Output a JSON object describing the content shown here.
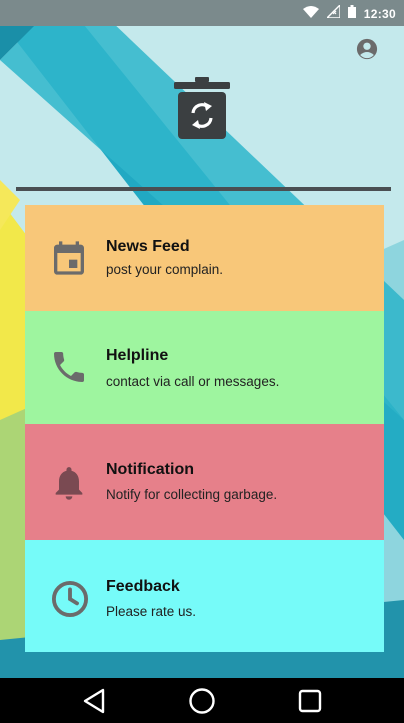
{
  "status_bar": {
    "time": "12:30",
    "icons": [
      "wifi-icon",
      "signal-icon",
      "battery-icon"
    ]
  },
  "header": {
    "profile_icon": "account-circle-icon",
    "logo_icon": "recycle-bin-icon"
  },
  "menu": [
    {
      "id": "news-feed",
      "title": "News Feed",
      "subtitle": "post your complain.",
      "icon": "calendar-icon",
      "color": "#f8c779"
    },
    {
      "id": "helpline",
      "title": "Helpline",
      "subtitle": "contact via call or messages.",
      "icon": "phone-icon",
      "color": "#9ef59f"
    },
    {
      "id": "notification",
      "title": "Notification",
      "subtitle": "Notify for collecting garbage.",
      "icon": "bell-icon",
      "color": "#e6808a"
    },
    {
      "id": "feedback",
      "title": "Feedback",
      "subtitle": "Please rate us.",
      "icon": "clock-icon",
      "color": "#76fbf9"
    }
  ],
  "nav_bar": {
    "buttons": [
      "back-icon",
      "home-icon",
      "recents-icon"
    ]
  },
  "colors": {
    "status_bar": "#7b8a8c",
    "divider": "#4a4f52",
    "icon_gray": "#6b6b6b",
    "nav_bar": "#000000"
  }
}
